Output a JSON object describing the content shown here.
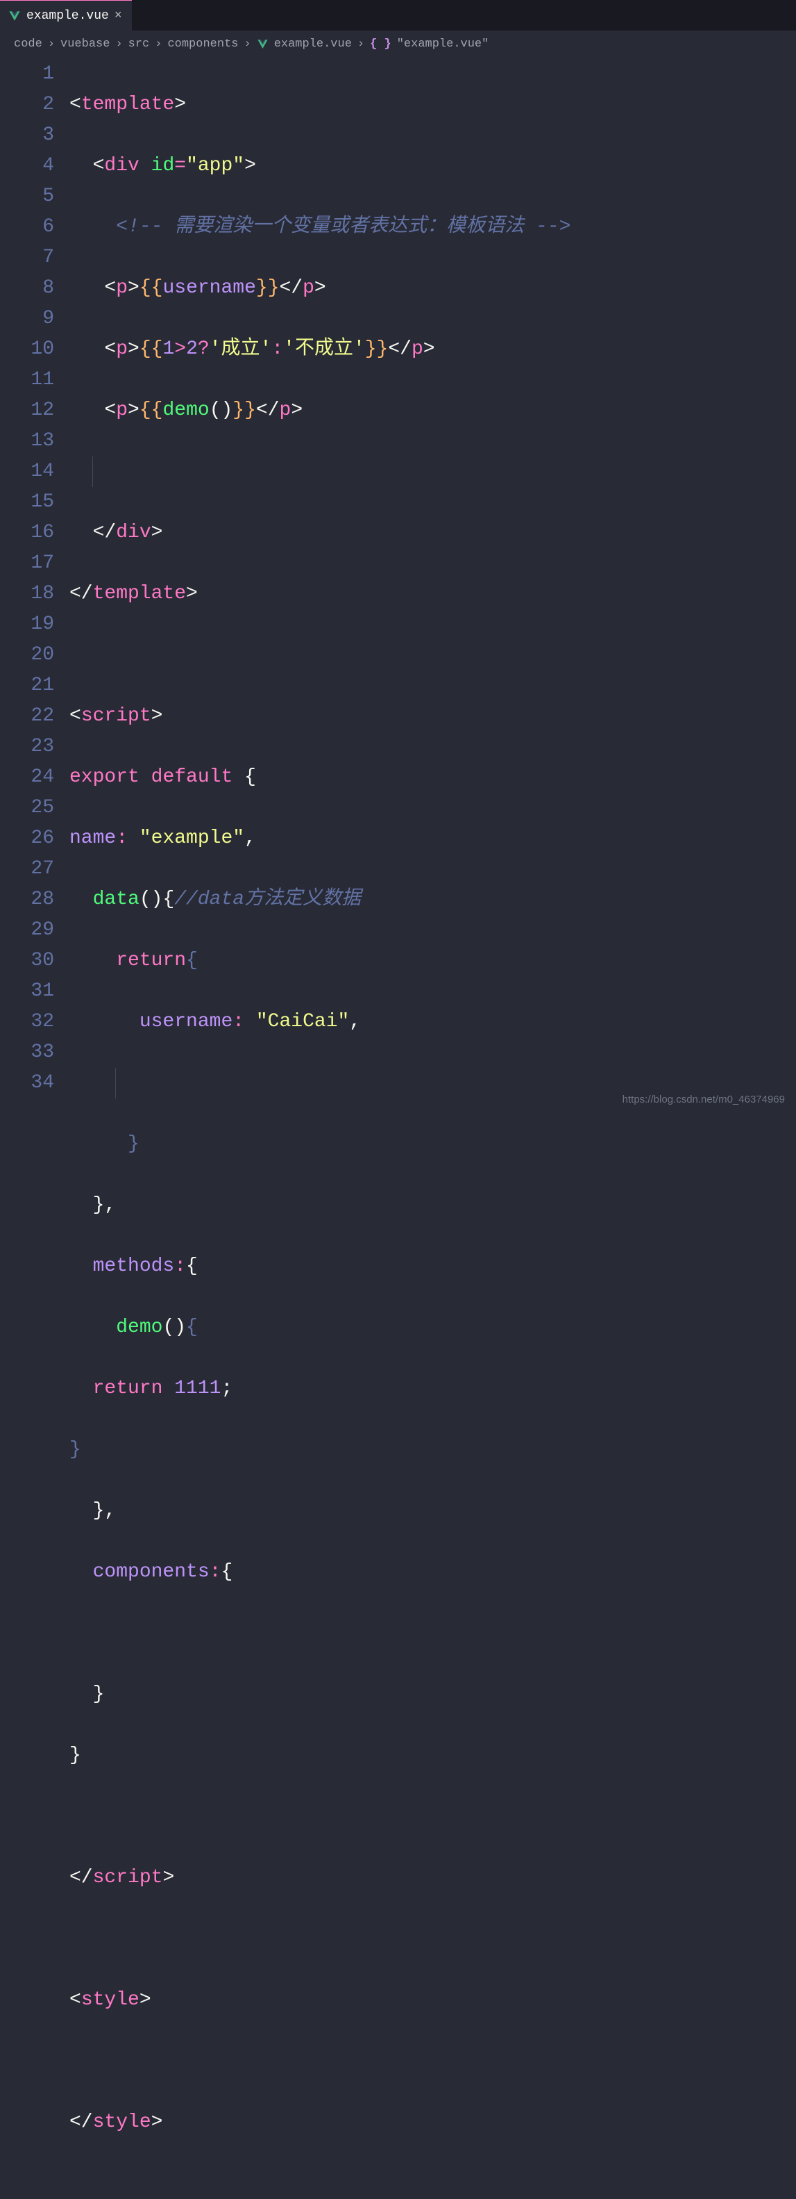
{
  "tab": {
    "filename": "example.vue",
    "close": "×"
  },
  "breadcrumb": {
    "parts": [
      "code",
      "vuebase",
      "src",
      "components",
      "example.vue",
      "\"example.vue\""
    ],
    "sep": "›"
  },
  "gutter": {
    "lines": [
      "1",
      "2",
      "3",
      "4",
      "5",
      "6",
      "7",
      "8",
      "9",
      "10",
      "11",
      "12",
      "13",
      "14",
      "15",
      "16",
      "17",
      "18",
      "19",
      "20",
      "21",
      "22",
      "23",
      "24",
      "25",
      "26",
      "27",
      "28",
      "29",
      "30",
      "31",
      "32",
      "33",
      "34"
    ]
  },
  "tok": {
    "lt": "<",
    "gt": ">",
    "lts": "</",
    "sp": " ",
    "eq": "=",
    "template": "template",
    "div": "div",
    "p": "p",
    "script": "script",
    "style": "style",
    "idattr": "id",
    "appstr": "\"app\"",
    "c1": "<!-- 需要渲染一个变量或者表达式：模板语法 -->",
    "mo": "{{",
    "mc": "}}",
    "username": "username",
    "demo": "demo",
    "par": "()",
    "n1": "1",
    "n2": "2",
    "q": "?",
    "col": ":",
    "s1": "'成立'",
    "s2": "'不成立'",
    "export": "export",
    "default": "default",
    "lcb": "{",
    "rcb": "}",
    "name": "name",
    "examplestr": "\"example\"",
    "comma": ",",
    "data": "data",
    "c2": "//data方法定义数据",
    "return": "return",
    "usernamek": "username",
    "caicai": "\"CaiCai\"",
    "methods": "methods",
    "n1111": "1111",
    "semi": ";",
    "components": "components"
  },
  "watermark": "https://blog.csdn.net/m0_46374969"
}
